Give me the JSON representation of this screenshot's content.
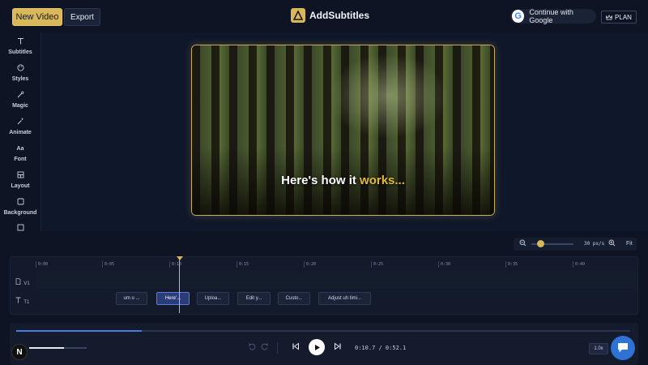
{
  "header": {
    "new_video_label": "New Video",
    "export_label": "Export",
    "app_title": "AddSubtitles",
    "google_label": "Continue with Google",
    "google_glyph": "G",
    "plan_label": "PLAN"
  },
  "sidebar": {
    "items": [
      {
        "label": "Subtitles",
        "icon": "text-t-icon"
      },
      {
        "label": "Styles",
        "icon": "palette-icon"
      },
      {
        "label": "Magic",
        "icon": "magic-wand-icon"
      },
      {
        "label": "Animate",
        "icon": "sparkle-wand-icon"
      },
      {
        "label": "Font",
        "icon": "font-icon",
        "glyph": "Aa"
      },
      {
        "label": "Layout",
        "icon": "layout-icon"
      },
      {
        "label": "Background",
        "icon": "square-icon"
      }
    ]
  },
  "preview": {
    "caption_plain": "Here's how it ",
    "caption_highlight": "works..."
  },
  "timeline": {
    "zoom_label": "30 px/s",
    "fit_label": "Fit",
    "ruler": [
      "0:00",
      "0:05",
      "0:10",
      "0:15",
      "0:20",
      "0:25",
      "0:30",
      "0:35",
      "0:40"
    ],
    "tracks": [
      {
        "id": "V1",
        "label": "V1"
      },
      {
        "id": "T1",
        "label": "T1"
      }
    ],
    "clips": [
      "um o ...",
      "Here'...",
      "Uploa...",
      "Edit y...",
      "Custo...",
      "Adjust uh timi..."
    ],
    "active_clip": 1,
    "playhead_time": "0:10.7"
  },
  "transport": {
    "avatar_letter": "N",
    "time_current": "0:10.7",
    "time_total": "0:52.1",
    "time_display": "0:10.7 / 0:52.1",
    "speed": "1.0x",
    "progress_fraction": 0.205,
    "volume_fraction": 0.6
  },
  "colors": {
    "accent_gold": "#d9b85c",
    "active_blue": "#2a3d7a",
    "chat_blue": "#2f72d6",
    "caption_highlight": "#e2b93b"
  }
}
